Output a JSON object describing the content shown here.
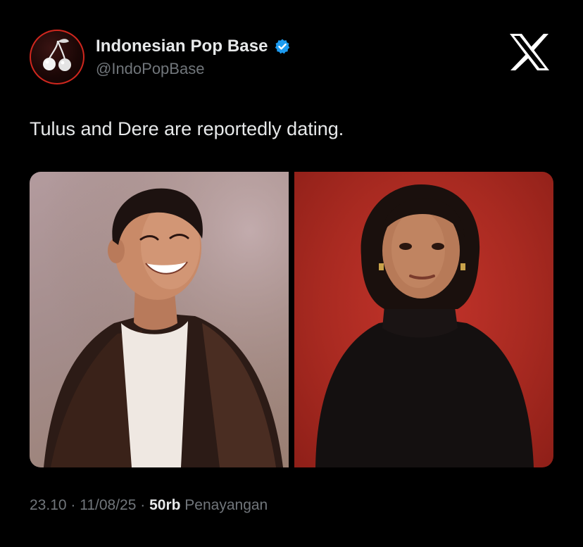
{
  "author": {
    "display_name": "Indonesian Pop Base",
    "handle": "@IndoPopBase",
    "verified": true,
    "avatar_icon": "cherries-icon"
  },
  "platform_icon": "x-logo-icon",
  "tweet": {
    "text": "Tulus and Dere are reportedly dating."
  },
  "media": [
    {
      "icon": "photo-man-laughing",
      "background": "#a48d8c"
    },
    {
      "icon": "photo-woman-portrait",
      "background": "#b02b22"
    }
  ],
  "footer": {
    "time": "23.10",
    "separator": " · ",
    "date": "11/08/25",
    "views_count": "50rb",
    "views_label": "Penayangan"
  },
  "colors": {
    "background": "#000000",
    "text_primary": "#e7e9ea",
    "text_secondary": "#71767b",
    "verified_blue": "#1d9bf0",
    "avatar_ring": "#d0271e"
  }
}
